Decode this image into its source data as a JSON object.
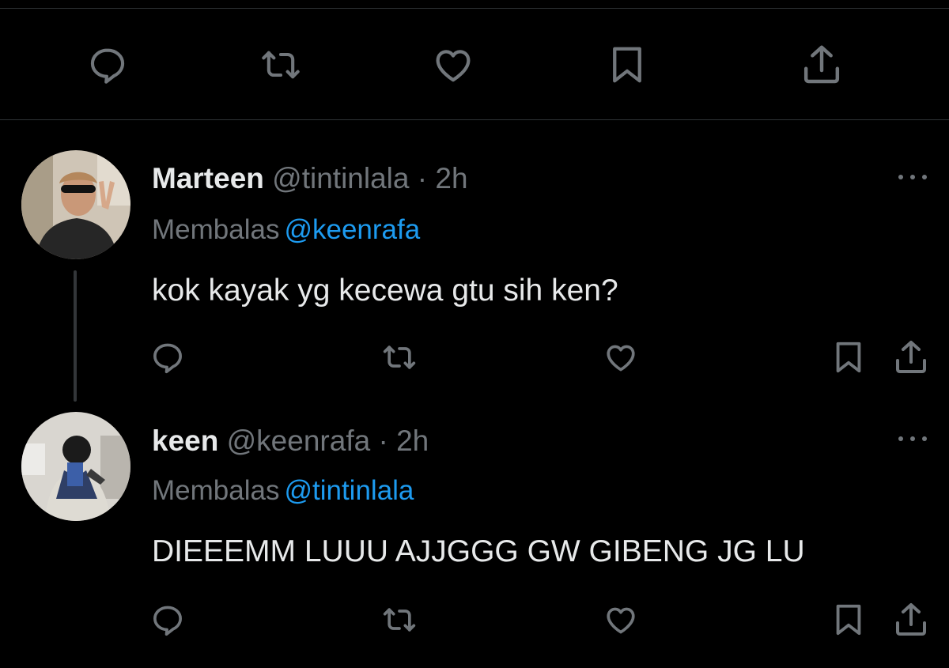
{
  "tweets": [
    {
      "name": "Marteen",
      "handle": "@tintinlala",
      "separator": "·",
      "time": "2h",
      "reply_prefix": "Membalas",
      "reply_to": "@keenrafa",
      "text": "kok kayak yg kecewa gtu sih ken?"
    },
    {
      "name": "keen",
      "handle": "@keenrafa",
      "separator": "·",
      "time": "2h",
      "reply_prefix": "Membalas",
      "reply_to": "@tintinlala",
      "text": "DIEEEMM LUUU AJJGGG GW GIBENG JG LU"
    }
  ],
  "icons": {
    "reply": "reply-icon",
    "retweet": "retweet-icon",
    "like": "heart-icon",
    "bookmark": "bookmark-icon",
    "share": "share-icon",
    "more": "more-icon"
  },
  "colors": {
    "background": "#000000",
    "text": "#e7e9ea",
    "muted": "#71767b",
    "link": "#1d9bf0",
    "divider": "#2f3336"
  }
}
